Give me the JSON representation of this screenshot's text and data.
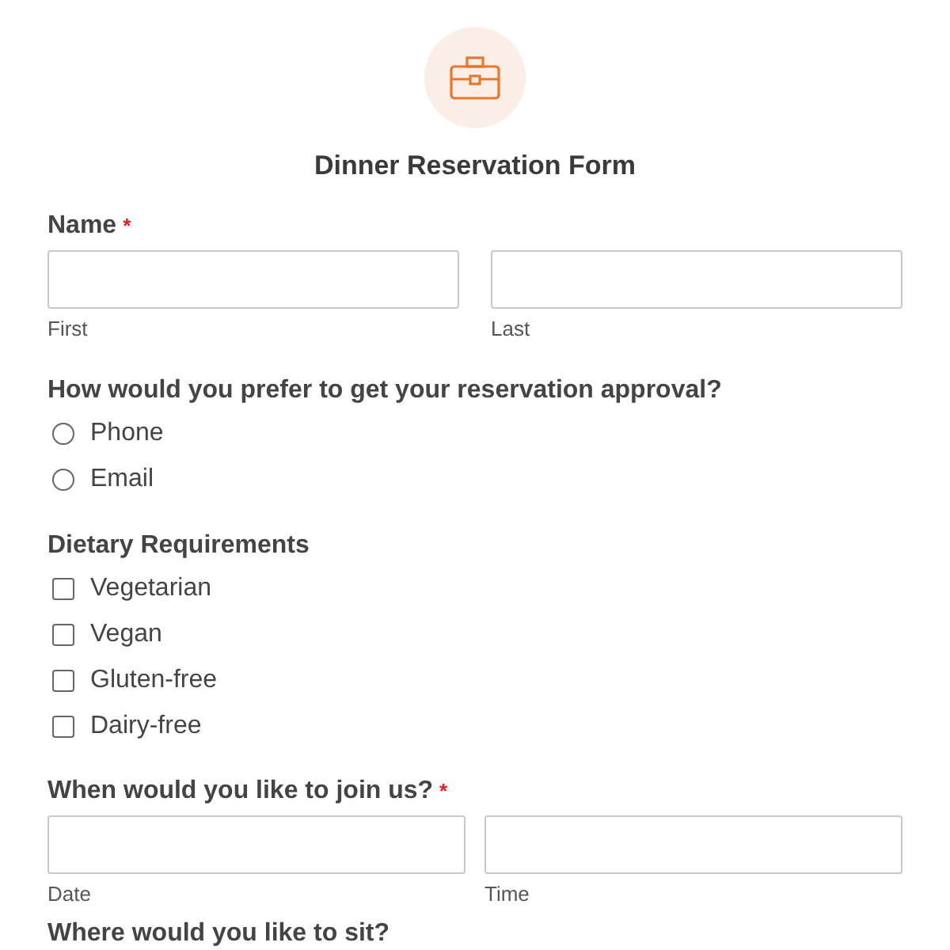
{
  "form": {
    "title": "Dinner Reservation Form"
  },
  "sections": [
    {
      "kind": "name",
      "label": "Name",
      "required_mark": "*",
      "fields": [
        {
          "sublabel": "First"
        },
        {
          "sublabel": "Last"
        }
      ]
    },
    {
      "kind": "radio",
      "label": "How would you prefer to get your reservation approval?",
      "options": [
        {
          "label": "Phone",
          "selected": false
        },
        {
          "label": "Email",
          "selected": false
        }
      ]
    },
    {
      "kind": "checkbox",
      "label": "Dietary Requirements",
      "options": [
        {
          "label": "Vegetarian",
          "checked": false
        },
        {
          "label": "Vegan",
          "checked": false
        },
        {
          "label": "Gluten-free",
          "checked": false
        },
        {
          "label": "Dairy-free",
          "checked": false
        }
      ]
    },
    {
      "kind": "datetime",
      "label": "When would you like to join us?",
      "required_mark": "*",
      "fields": [
        {
          "sublabel": "Date"
        },
        {
          "sublabel": "Time"
        }
      ]
    },
    {
      "kind": "heading",
      "label": "Where would you like to sit?"
    }
  ]
}
